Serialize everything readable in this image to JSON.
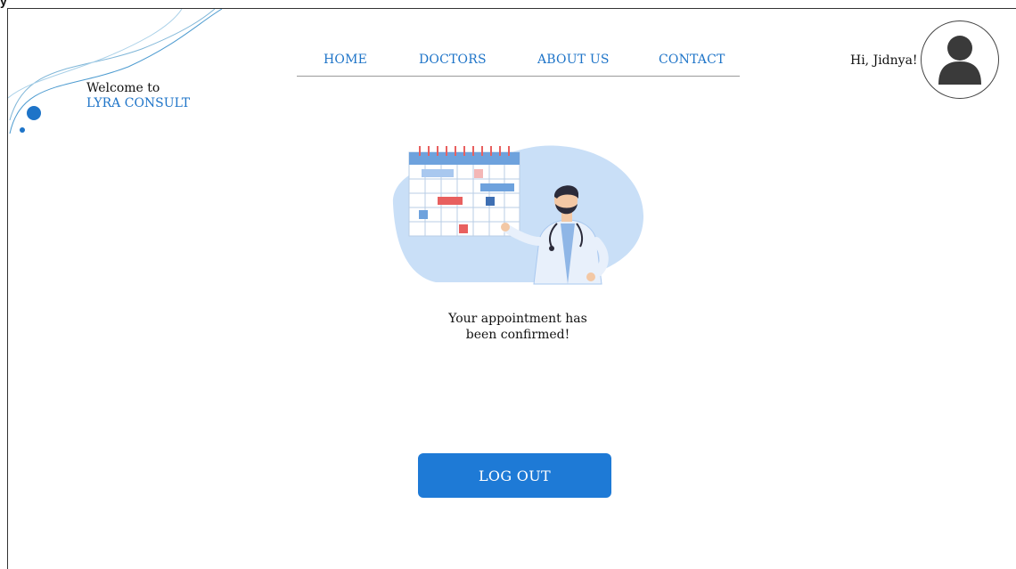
{
  "window": {
    "title_fragment": "y"
  },
  "brand": {
    "welcome_text": "Welcome to",
    "name": "LYRA CONSULT"
  },
  "nav": {
    "items": [
      {
        "label": "HOME"
      },
      {
        "label": "DOCTORS"
      },
      {
        "label": "ABOUT US"
      },
      {
        "label": "CONTACT"
      }
    ]
  },
  "user": {
    "greeting": "Hi, Jidnya!",
    "avatar_icon": "user-icon"
  },
  "main": {
    "illustration_icon": "doctor-calendar-illustration",
    "message_line1": "Your appointment has",
    "message_line2": "been confirmed!"
  },
  "actions": {
    "logout_label": "LOG OUT"
  },
  "colors": {
    "accent": "#1e74c8",
    "button": "#1e7ad6",
    "illustration_blob": "#c9dff7",
    "calendar_red": "#e8605f"
  }
}
